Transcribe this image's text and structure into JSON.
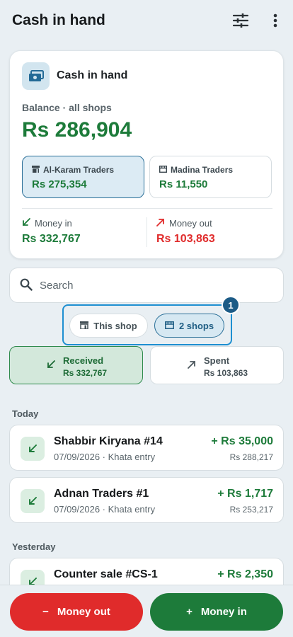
{
  "appbar": {
    "title": "Cash in hand",
    "filter_icon": "tune-icon",
    "more_icon": "more-vert-icon"
  },
  "summary": {
    "title": "Cash in hand",
    "icon": "cash-icon",
    "balance_label": "Balance · all shops",
    "balance_value": "Rs 286,904",
    "shops": [
      {
        "name": "Al-Karam Traders",
        "amount": "Rs 275,354",
        "selected": true,
        "icon": "store-icon"
      },
      {
        "name": "Madina Traders",
        "amount": "Rs 11,550",
        "selected": false,
        "icon": "store-front-icon"
      }
    ],
    "money_in": {
      "label": "Money in",
      "value": "Rs 332,767"
    },
    "money_out": {
      "label": "Money out",
      "value": "Rs 103,863"
    }
  },
  "search": {
    "placeholder": "Search"
  },
  "scope": {
    "this_shop": "This shop",
    "two_shops": "2 shops",
    "badge": "1"
  },
  "filters": {
    "received": {
      "label": "Received",
      "amount": "Rs 332,767"
    },
    "spent": {
      "label": "Spent",
      "amount": "Rs 103,863"
    }
  },
  "sections": {
    "today": {
      "label": "Today",
      "items": [
        {
          "name": "Shabbir Kiryana #14",
          "meta": "07/09/2026 · Khata entry",
          "amount": "+ Rs 35,000",
          "balance": "Rs 288,217"
        },
        {
          "name": "Adnan Traders #1",
          "meta": "07/09/2026 · Khata entry",
          "amount": "+ Rs 1,717",
          "balance": "Rs 253,217"
        }
      ]
    },
    "yesterday": {
      "label": "Yesterday",
      "items": [
        {
          "name": "Counter sale #CS-1",
          "amount": "+ Rs 2,350"
        }
      ]
    }
  },
  "actions": {
    "money_out": "Money out",
    "money_out_sign": "−",
    "money_in": "Money in",
    "money_in_sign": "+"
  },
  "colors": {
    "green": "#1d7b3a",
    "red": "#e02b2b",
    "blue": "#1e8fd1",
    "navy": "#1c5b86"
  }
}
